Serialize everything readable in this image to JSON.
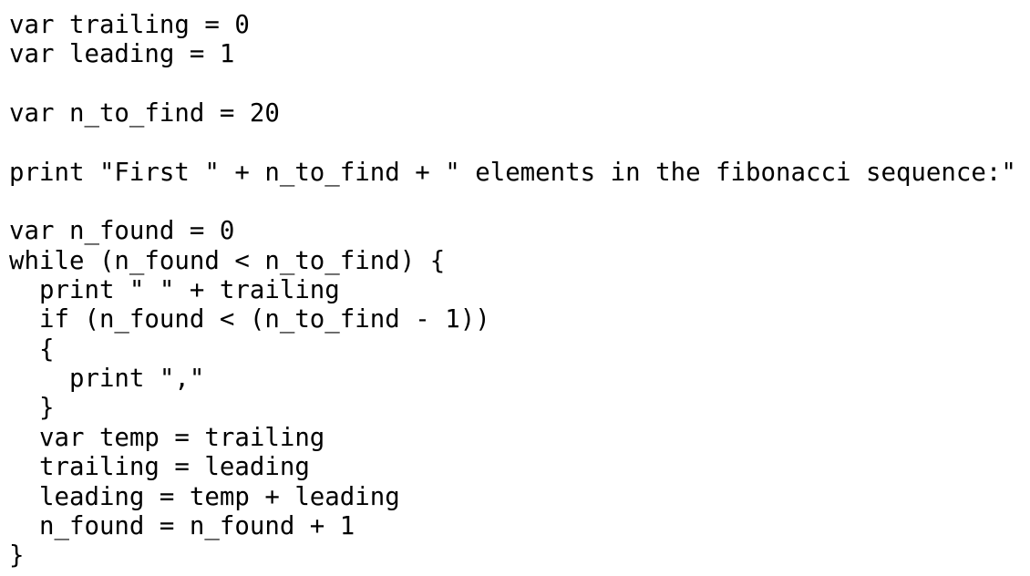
{
  "editor": {
    "lines": [
      "var trailing = 0",
      "var leading = 1",
      "",
      "var n_to_find = 20",
      "",
      "print \"First \" + n_to_find + \" elements in the fibonacci sequence:\"",
      "",
      "var n_found = 0",
      "while (n_found < n_to_find) {",
      "  print \" \" + trailing",
      "  if (n_found < (n_to_find - 1))",
      "  {",
      "    print \",\"",
      "  }",
      "  var temp = trailing",
      "  trailing = leading",
      "  leading = temp + leading",
      "  n_found = n_found + 1",
      "}"
    ]
  },
  "colors": {
    "background": "#ffffff",
    "text": "#000000"
  }
}
